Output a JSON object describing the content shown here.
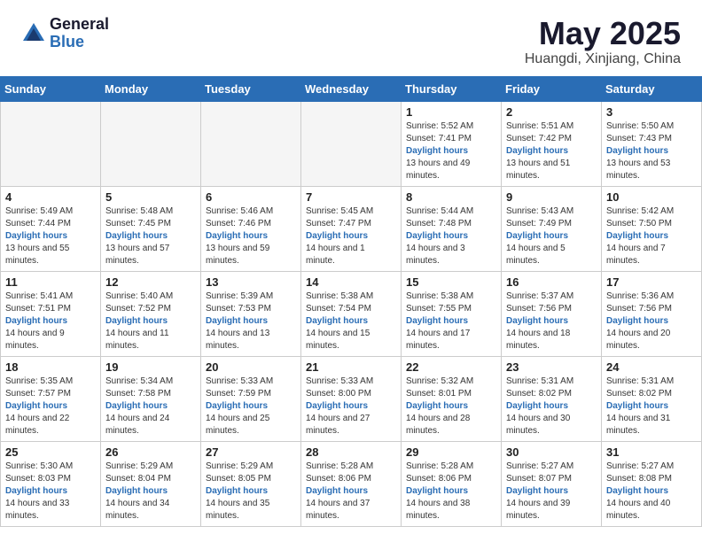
{
  "header": {
    "logo_general": "General",
    "logo_blue": "Blue",
    "month_title": "May 2025",
    "location": "Huangdi, Xinjiang, China"
  },
  "weekdays": [
    "Sunday",
    "Monday",
    "Tuesday",
    "Wednesday",
    "Thursday",
    "Friday",
    "Saturday"
  ],
  "weeks": [
    [
      {
        "day": "",
        "empty": true
      },
      {
        "day": "",
        "empty": true
      },
      {
        "day": "",
        "empty": true
      },
      {
        "day": "",
        "empty": true
      },
      {
        "day": "1",
        "sunrise": "5:52 AM",
        "sunset": "7:41 PM",
        "daylight": "13 hours and 49 minutes."
      },
      {
        "day": "2",
        "sunrise": "5:51 AM",
        "sunset": "7:42 PM",
        "daylight": "13 hours and 51 minutes."
      },
      {
        "day": "3",
        "sunrise": "5:50 AM",
        "sunset": "7:43 PM",
        "daylight": "13 hours and 53 minutes."
      }
    ],
    [
      {
        "day": "4",
        "sunrise": "5:49 AM",
        "sunset": "7:44 PM",
        "daylight": "13 hours and 55 minutes."
      },
      {
        "day": "5",
        "sunrise": "5:48 AM",
        "sunset": "7:45 PM",
        "daylight": "13 hours and 57 minutes."
      },
      {
        "day": "6",
        "sunrise": "5:46 AM",
        "sunset": "7:46 PM",
        "daylight": "13 hours and 59 minutes."
      },
      {
        "day": "7",
        "sunrise": "5:45 AM",
        "sunset": "7:47 PM",
        "daylight": "14 hours and 1 minute."
      },
      {
        "day": "8",
        "sunrise": "5:44 AM",
        "sunset": "7:48 PM",
        "daylight": "14 hours and 3 minutes."
      },
      {
        "day": "9",
        "sunrise": "5:43 AM",
        "sunset": "7:49 PM",
        "daylight": "14 hours and 5 minutes."
      },
      {
        "day": "10",
        "sunrise": "5:42 AM",
        "sunset": "7:50 PM",
        "daylight": "14 hours and 7 minutes."
      }
    ],
    [
      {
        "day": "11",
        "sunrise": "5:41 AM",
        "sunset": "7:51 PM",
        "daylight": "14 hours and 9 minutes."
      },
      {
        "day": "12",
        "sunrise": "5:40 AM",
        "sunset": "7:52 PM",
        "daylight": "14 hours and 11 minutes."
      },
      {
        "day": "13",
        "sunrise": "5:39 AM",
        "sunset": "7:53 PM",
        "daylight": "14 hours and 13 minutes."
      },
      {
        "day": "14",
        "sunrise": "5:38 AM",
        "sunset": "7:54 PM",
        "daylight": "14 hours and 15 minutes."
      },
      {
        "day": "15",
        "sunrise": "5:38 AM",
        "sunset": "7:55 PM",
        "daylight": "14 hours and 17 minutes."
      },
      {
        "day": "16",
        "sunrise": "5:37 AM",
        "sunset": "7:56 PM",
        "daylight": "14 hours and 18 minutes."
      },
      {
        "day": "17",
        "sunrise": "5:36 AM",
        "sunset": "7:56 PM",
        "daylight": "14 hours and 20 minutes."
      }
    ],
    [
      {
        "day": "18",
        "sunrise": "5:35 AM",
        "sunset": "7:57 PM",
        "daylight": "14 hours and 22 minutes."
      },
      {
        "day": "19",
        "sunrise": "5:34 AM",
        "sunset": "7:58 PM",
        "daylight": "14 hours and 24 minutes."
      },
      {
        "day": "20",
        "sunrise": "5:33 AM",
        "sunset": "7:59 PM",
        "daylight": "14 hours and 25 minutes."
      },
      {
        "day": "21",
        "sunrise": "5:33 AM",
        "sunset": "8:00 PM",
        "daylight": "14 hours and 27 minutes."
      },
      {
        "day": "22",
        "sunrise": "5:32 AM",
        "sunset": "8:01 PM",
        "daylight": "14 hours and 28 minutes."
      },
      {
        "day": "23",
        "sunrise": "5:31 AM",
        "sunset": "8:02 PM",
        "daylight": "14 hours and 30 minutes."
      },
      {
        "day": "24",
        "sunrise": "5:31 AM",
        "sunset": "8:02 PM",
        "daylight": "14 hours and 31 minutes."
      }
    ],
    [
      {
        "day": "25",
        "sunrise": "5:30 AM",
        "sunset": "8:03 PM",
        "daylight": "14 hours and 33 minutes."
      },
      {
        "day": "26",
        "sunrise": "5:29 AM",
        "sunset": "8:04 PM",
        "daylight": "14 hours and 34 minutes."
      },
      {
        "day": "27",
        "sunrise": "5:29 AM",
        "sunset": "8:05 PM",
        "daylight": "14 hours and 35 minutes."
      },
      {
        "day": "28",
        "sunrise": "5:28 AM",
        "sunset": "8:06 PM",
        "daylight": "14 hours and 37 minutes."
      },
      {
        "day": "29",
        "sunrise": "5:28 AM",
        "sunset": "8:06 PM",
        "daylight": "14 hours and 38 minutes."
      },
      {
        "day": "30",
        "sunrise": "5:27 AM",
        "sunset": "8:07 PM",
        "daylight": "14 hours and 39 minutes."
      },
      {
        "day": "31",
        "sunrise": "5:27 AM",
        "sunset": "8:08 PM",
        "daylight": "14 hours and 40 minutes."
      }
    ]
  ]
}
